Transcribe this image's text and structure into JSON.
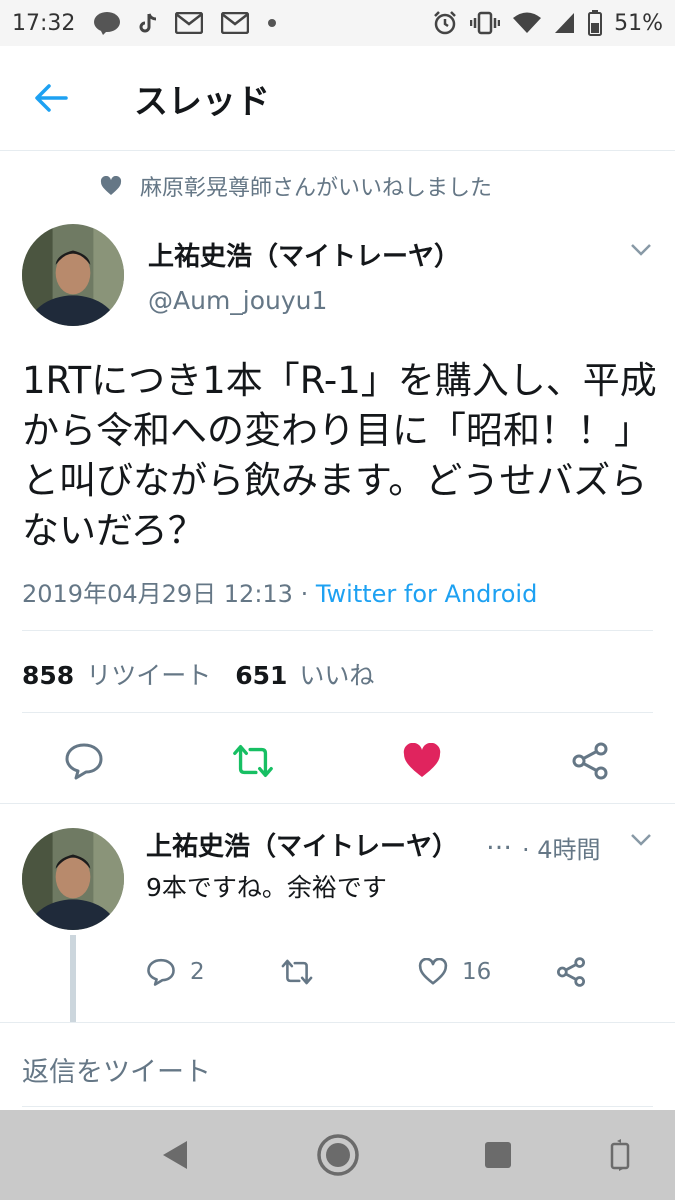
{
  "status_bar": {
    "time": "17:32",
    "battery": "51%",
    "left_icons": [
      "line-app-icon",
      "tiktok-icon",
      "au-mail-icon",
      "au-mail-icon",
      "dot-icon"
    ],
    "right_icons": [
      "alarm-icon",
      "vibrate-icon",
      "wifi-icon",
      "cell-signal-icon",
      "battery-icon"
    ]
  },
  "header": {
    "title": "スレッド"
  },
  "liked_by": "麻原彰晃尊師さんがいいねしました",
  "tweet": {
    "name": "上祐史浩（マイトレーヤ）",
    "handle": "@Aum_jouyu1",
    "text": "1RTにつき1本「R-1」を購入し、平成から令和への変わり目に「昭和！！」と叫びながら飲みます。どうせバズらないだろ？",
    "timestamp": "2019年04月29日 12:13",
    "separator": " · ",
    "source": "Twitter for Android",
    "retweet_count": "858",
    "retweet_label": "リツイート",
    "like_count": "651",
    "like_label": "いいね"
  },
  "reply": {
    "name": "上祐史浩（マイトレーヤ）",
    "ellipsis": "…",
    "time": "· 4時間",
    "text": "9本ですね。余裕です",
    "reply_count": "2",
    "like_count": "16"
  },
  "compose_placeholder": "返信をツイート",
  "colors": {
    "accent": "#1da1f2",
    "retweet": "#17bf63",
    "like": "#e0245e",
    "muted": "#657786"
  }
}
